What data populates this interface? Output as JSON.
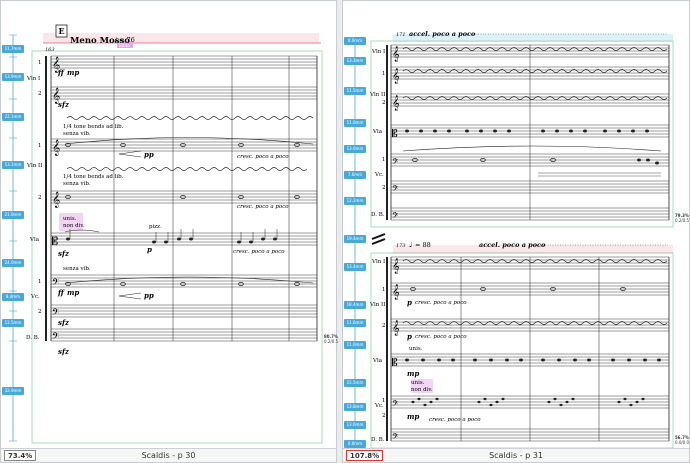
{
  "left_page": {
    "footer_label": "Scaldis - p 30",
    "zoom": "73.4%",
    "rehearsal_mark": "E",
    "tempo_text": "Meno Mosso",
    "tempo_value": "= 76",
    "tempo_tag": "Hide",
    "measure_number": "163",
    "instruments": [
      "Vln I",
      "Vln II",
      "Vla",
      "Vc.",
      "D. B."
    ],
    "part_numbers": [
      "1",
      "2",
      "1",
      "2",
      "1",
      "2"
    ],
    "dynamics": [
      "ff",
      "mp",
      "sfz",
      "pp",
      "sfz",
      "ff",
      "mp",
      "sfz",
      "pp",
      "sfz"
    ],
    "expressions": {
      "bends_1": "1/4 tone bends ad lib.",
      "senza_1": "senza vib.",
      "bends_2": "1/4 tone bends ad lib.",
      "senza_2": "senza vib.",
      "cresc_1": "cresc. poco a poco",
      "cresc_2": "cresc. poco a poco",
      "unis": "unis.",
      "non_div": "non div.",
      "pizz": "pizz.",
      "pizz_dyn": "p",
      "cresc_3": "cresc. poco a poco",
      "senza_3": "senza vib."
    },
    "ruler_labels": [
      "11.7mm",
      "13.9mm",
      "22.1mm",
      "13.1mm",
      "21.0mm",
      "24.0mm",
      "8.4mm",
      "12.5mm",
      "32.9mm"
    ],
    "percent_badge": [
      "80.7%",
      "0.2/0.5"
    ]
  },
  "right_page": {
    "footer_label": "Scaldis - p 31",
    "zoom": "107.8%",
    "system1": {
      "measure_number": "171",
      "heading": "accel. poco a poco",
      "instruments": [
        "Vln I",
        "Vln II",
        "Vla",
        "Vc.",
        "D. B."
      ],
      "part_numbers": [
        "1",
        "2",
        "1",
        "2"
      ]
    },
    "system2": {
      "measure_number": "173",
      "tempo_value": "= 88",
      "heading": "accel. poco a poco",
      "instruments": [
        "Vln I",
        "Vln II",
        "Vla",
        "Vc.",
        "D. B."
      ],
      "part_numbers": [
        "1",
        "2",
        "1",
        "2"
      ],
      "expressions": {
        "p_1": "p",
        "cresc_1": "cresc. poco a poco",
        "p_2": "p",
        "cresc_2": "cresc. poco a poco",
        "unis": "unis.",
        "mp_1": "mp",
        "unis_2": "unis.",
        "non_div": "non div.",
        "mp_2": "mp",
        "cresc_3": "cresc. poco a poco"
      }
    },
    "ruler_labels": [
      "0.0mm",
      "13.3mm",
      "11.5mm",
      "11.0mm",
      "13.0mm",
      "7.6mm",
      "12.2mm",
      "19.4mm",
      "13.4mm",
      "18.4mm",
      "11.6mm",
      "11.0mm",
      "15.5mm",
      "13.8mm",
      "13.6mm",
      "0.0mm"
    ],
    "percent_badge_1": [
      "79.3%",
      "0.2/0.5"
    ],
    "percent_badge_2": [
      "56.7%",
      "0.0/0.0"
    ]
  }
}
